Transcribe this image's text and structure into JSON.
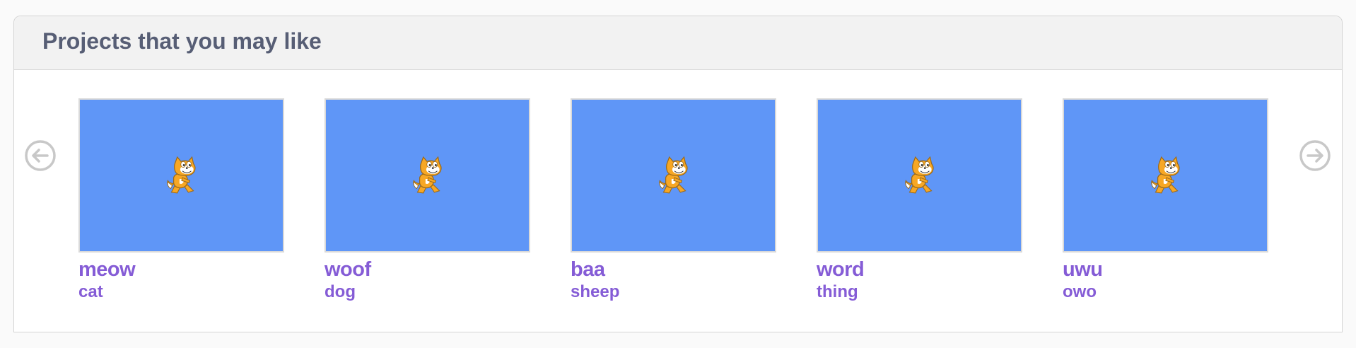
{
  "section": {
    "title": "Projects that you may like"
  },
  "colors": {
    "accent": "#855cd6",
    "thumbnail_bg": "#5f96f7",
    "title_text": "#575e75",
    "header_bg": "#f2f2f2"
  },
  "icons": {
    "previous": "arrow-left-circle-icon",
    "next": "arrow-right-circle-icon",
    "thumbnail": "scratch-cat-icon"
  },
  "projects": [
    {
      "title": "meow",
      "author": "cat"
    },
    {
      "title": "woof",
      "author": "dog"
    },
    {
      "title": "baa",
      "author": "sheep"
    },
    {
      "title": "word",
      "author": "thing"
    },
    {
      "title": "uwu",
      "author": "owo"
    }
  ]
}
